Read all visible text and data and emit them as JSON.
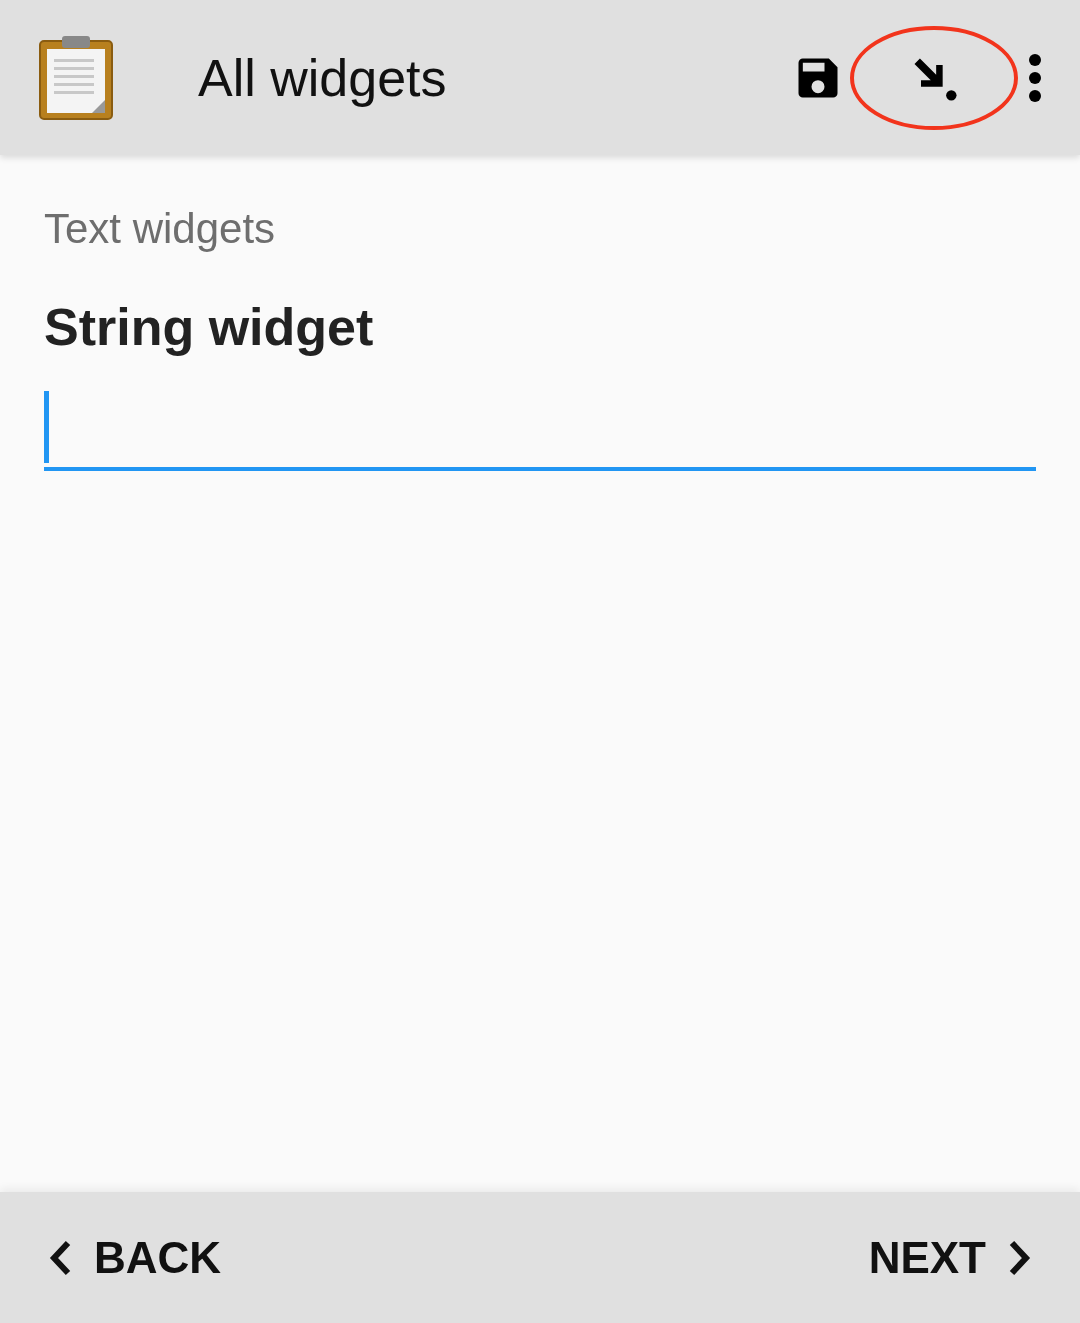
{
  "toolbar": {
    "title": "All widgets",
    "actions": [
      {
        "kind": "save",
        "highlighted": false
      },
      {
        "kind": "jump",
        "highlighted": true
      },
      {
        "kind": "menu",
        "highlighted": false
      }
    ]
  },
  "group_label": "Text widgets",
  "question": {
    "label": "String widget",
    "focused": true
  },
  "navigation": {
    "back": "BACK",
    "next": "NEXT"
  }
}
